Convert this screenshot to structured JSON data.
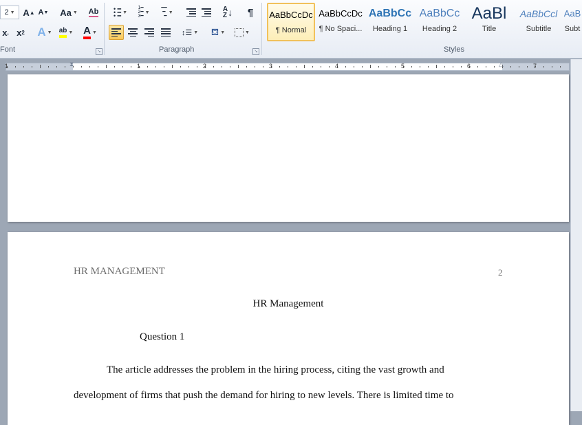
{
  "ribbon": {
    "font_group_label": "Font",
    "paragraph_group_label": "Paragraph",
    "styles_group_label": "Styles",
    "change_case_label": "Aa",
    "styles": [
      {
        "preview": "AaBbCcDc",
        "name": "¶ Normal",
        "color": "#000000"
      },
      {
        "preview": "AaBbCcDc",
        "name": "¶ No Spaci...",
        "color": "#000000"
      },
      {
        "preview": "AaBbCc",
        "name": "Heading 1",
        "color": "#2e74b5"
      },
      {
        "preview": "AaBbCc",
        "name": "Heading 2",
        "color": "#4f81bd"
      },
      {
        "preview": "AaBl",
        "name": "Title",
        "color": "#17365d"
      },
      {
        "preview": "AaBbCcl",
        "name": "Subtitle",
        "color": "#4f81bd"
      },
      {
        "preview": "AaB",
        "name": "Subt",
        "color": "#4f81bd"
      }
    ]
  },
  "ruler": {
    "numbers": [
      "1",
      "1",
      "2",
      "3",
      "4",
      "5",
      "6",
      "7"
    ]
  },
  "document": {
    "header_left": "HR MANAGEMENT",
    "page_number": "2",
    "title": "HR Management",
    "subheading": "Question 1",
    "body_lines": [
      "The article addresses the problem in the hiring process, citing the vast growth and",
      "development of firms that push the demand for hiring to new levels. There is limited time to"
    ]
  },
  "colors": {
    "active_style_border": "#f1c15b",
    "highlight_yellow": "#ffff00",
    "font_color_red": "#ff0000"
  }
}
